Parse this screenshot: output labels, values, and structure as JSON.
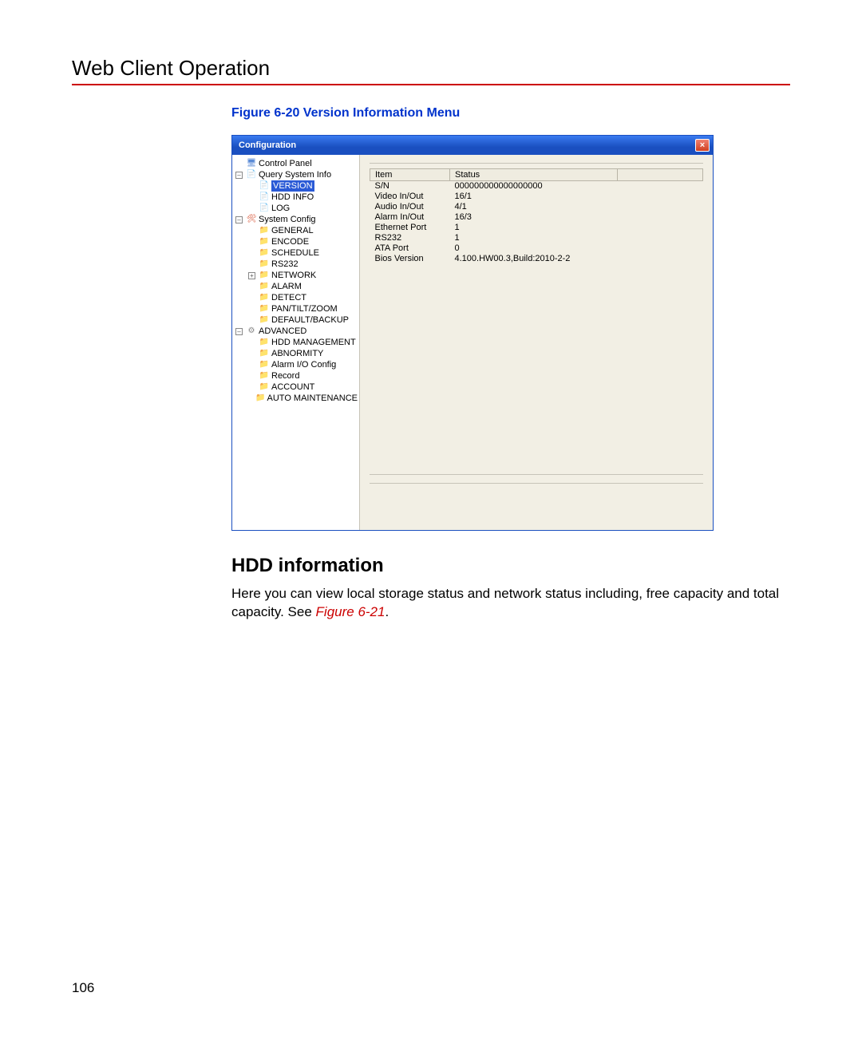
{
  "page_title": "Web Client Operation",
  "figure_caption": "Figure 6-20 Version Information Menu",
  "window": {
    "title": "Configuration",
    "close": "×"
  },
  "tree": {
    "root": "Control Panel",
    "query": "Query System Info",
    "version": "VERSION",
    "hdd_info": "HDD INFO",
    "log": "LOG",
    "sysconfig": "System Config",
    "general": "GENERAL",
    "encode": "ENCODE",
    "schedule": "SCHEDULE",
    "rs232": "RS232",
    "network": "NETWORK",
    "alarm": "ALARM",
    "detect": "DETECT",
    "ptz": "PAN/TILT/ZOOM",
    "defbackup": "DEFAULT/BACKUP",
    "advanced": "ADVANCED",
    "hddm": "HDD MANAGEMENT",
    "abnorm": "ABNORMITY",
    "alarmio": "Alarm I/O Config",
    "record": "Record",
    "account": "ACCOUNT",
    "automaint": "AUTO MAINTENANCE"
  },
  "table": {
    "h_item": "Item",
    "h_status": "Status",
    "rows": [
      {
        "item": "S/N",
        "status": "000000000000000000"
      },
      {
        "item": "Video In/Out",
        "status": "16/1"
      },
      {
        "item": "Audio In/Out",
        "status": "4/1"
      },
      {
        "item": "Alarm In/Out",
        "status": "16/3"
      },
      {
        "item": "Ethernet Port",
        "status": "1"
      },
      {
        "item": "RS232",
        "status": "1"
      },
      {
        "item": "ATA Port",
        "status": "0"
      },
      {
        "item": "Bios Version",
        "status": "4.100.HW00.3,Build:2010-2-2"
      }
    ]
  },
  "section_heading": "HDD information",
  "body_text_1": "Here you can view local storage status and network status including, free capacity and total capacity. See ",
  "fig_ref": "Figure 6-21",
  "body_text_2": ".",
  "page_number": "106"
}
